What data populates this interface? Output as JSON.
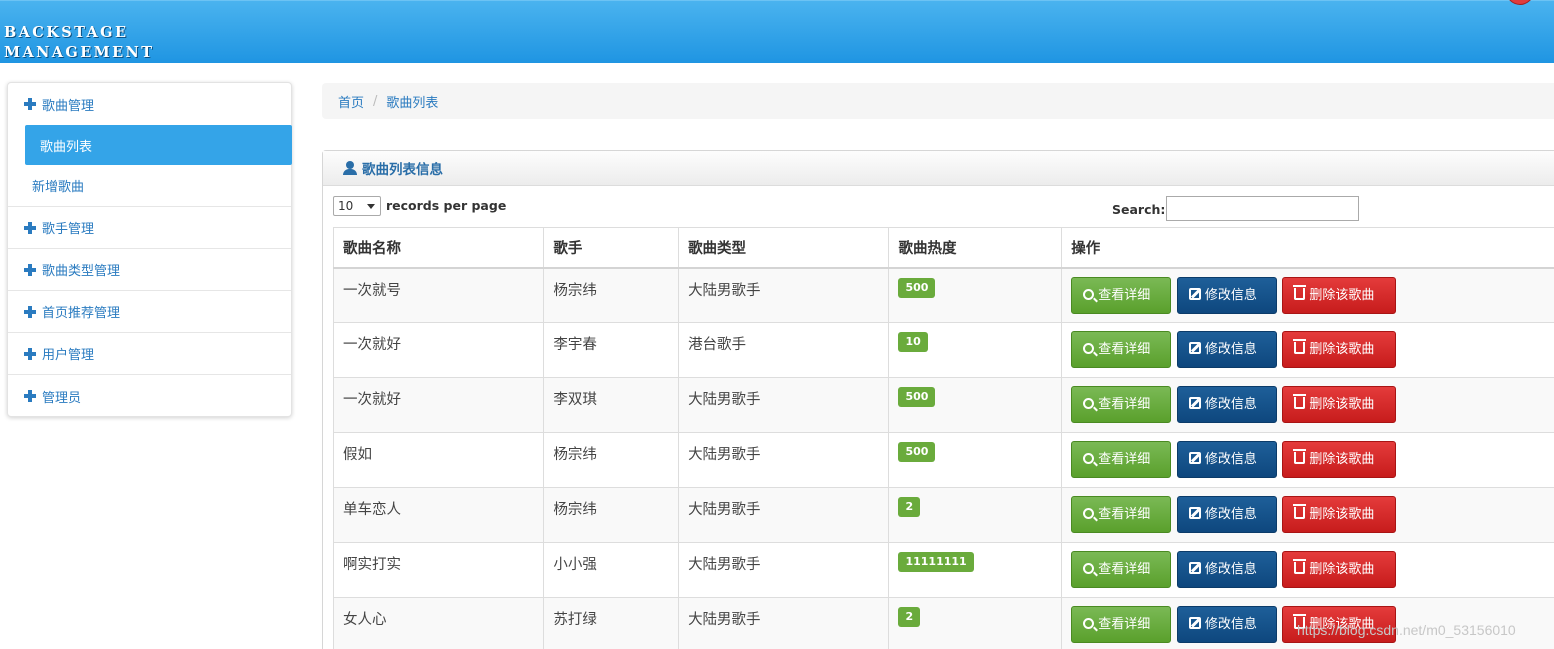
{
  "header": {
    "brand_line1": "BACKSTAGE",
    "brand_line2": "MANAGEMENT"
  },
  "sidebar": {
    "groups": [
      {
        "label": "歌曲管理"
      },
      {
        "label": "歌手管理"
      },
      {
        "label": "歌曲类型管理"
      },
      {
        "label": "首页推荐管理"
      },
      {
        "label": "用户管理"
      },
      {
        "label": "管理员"
      }
    ],
    "sub_items": [
      {
        "label": "歌曲列表",
        "active": true
      },
      {
        "label": "新增歌曲",
        "active": false
      }
    ]
  },
  "breadcrumb": {
    "home": "首页",
    "separator": "/",
    "current": "歌曲列表"
  },
  "panel": {
    "title": "歌曲列表信息"
  },
  "table_controls": {
    "page_length": "10",
    "page_length_suffix": "records per page",
    "search_label": "Search:",
    "search_value": ""
  },
  "table": {
    "headers": [
      "歌曲名称",
      "歌手",
      "歌曲类型",
      "歌曲热度",
      "操作"
    ],
    "rows": [
      {
        "name": "一次就号",
        "singer": "杨宗纬",
        "type": "大陆男歌手",
        "heat": "500"
      },
      {
        "name": "一次就好",
        "singer": "李宇春",
        "type": "港台歌手",
        "heat": "10"
      },
      {
        "name": "一次就好",
        "singer": "李双琪",
        "type": "大陆男歌手",
        "heat": "500"
      },
      {
        "name": "假如",
        "singer": "杨宗纬",
        "type": "大陆男歌手",
        "heat": "500"
      },
      {
        "name": "单车恋人",
        "singer": "杨宗纬",
        "type": "大陆男歌手",
        "heat": "2"
      },
      {
        "name": "啊实打实",
        "singer": "小小强",
        "type": "大陆男歌手",
        "heat": "11111111"
      },
      {
        "name": "女人心",
        "singer": "苏打绿",
        "type": "大陆男歌手",
        "heat": "2"
      }
    ],
    "actions": {
      "view": "查看详细",
      "edit": "修改信息",
      "delete": "删除该歌曲"
    }
  },
  "watermark": "https://blog.csdn.net/m0_53156010",
  "colors": {
    "header_blue": "#1f95e2",
    "link_blue": "#2a7bc0",
    "badge_green": "#6aab3c",
    "btn_green": "#5aa02c",
    "btn_blue": "#0e477e",
    "btn_red": "#c71c1c"
  },
  "icons": {
    "group_icon": "plus-icon",
    "panel_icon": "user-icon",
    "view_icon": "zoom-in-icon",
    "edit_icon": "edit-icon",
    "delete_icon": "trash-icon"
  }
}
